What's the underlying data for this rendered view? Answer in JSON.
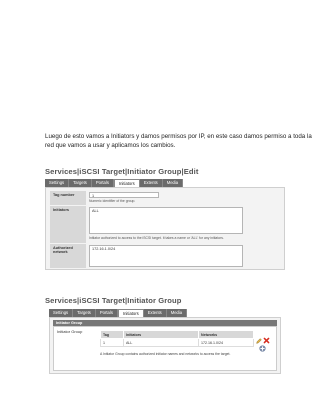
{
  "paragraph": {
    "line1": "Luego de esto vamos a  Initiators y damos permisos por IP, en este caso damos permiso a toda la",
    "line2": "red que vamos a usar y aplicamos los cambios."
  },
  "shot1": {
    "title": "Services|iSCSI Target|Initiator Group|Edit",
    "tabs": [
      "Settings",
      "Targets",
      "Portals",
      "Initiators",
      "Extents",
      "Media"
    ],
    "fields": {
      "tag_label": "Tag number",
      "tag_value": "1",
      "tag_help": "Numeric identifier of the group.",
      "initiators_label": "Initiators",
      "initiators_value": "ALL",
      "initiators_help": "Initiator authorized to access to the iSCSI target. It takes a name or 'ALL' for any initiators.",
      "network_label": "Authorized network",
      "network_value": "172.16.1.0/24"
    }
  },
  "shot2": {
    "title": "Services|iSCSI Target|Initiator Group",
    "tabs": [
      "Settings",
      "Targets",
      "Portals",
      "Initiators",
      "Extents",
      "Media"
    ],
    "group_header": "Initiator Group",
    "left_label": "Initiator Group",
    "table": {
      "headers": [
        "Tag",
        "Initiators",
        "Networks"
      ],
      "row": [
        "1",
        "ALL",
        "172.16.1.0/24"
      ]
    },
    "note": "A Initiator Group contains authorized initiator names and networks to access the target."
  },
  "colors": {
    "tab_bar": "#6b6b6b",
    "panel_bg": "#f3f3f3",
    "label_bg": "#d8d8d8"
  },
  "icons": [
    "edit-icon",
    "delete-icon",
    "add-icon"
  ]
}
